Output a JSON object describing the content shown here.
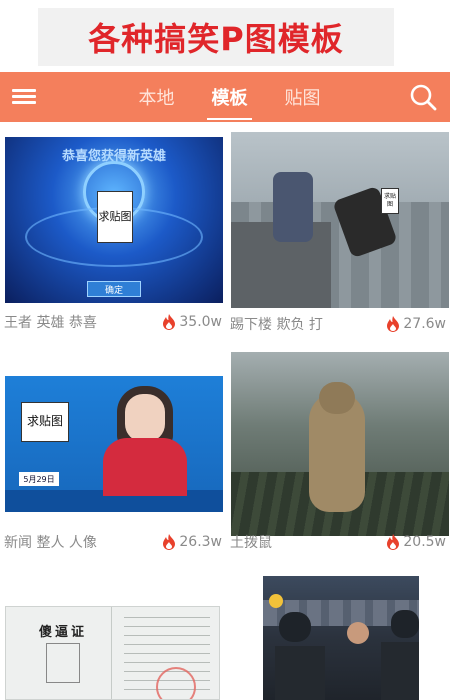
{
  "banner": {
    "title": "各种搞笑P图模板"
  },
  "header": {
    "tabs": [
      {
        "label": "本地",
        "active": false
      },
      {
        "label": "模板",
        "active": true
      },
      {
        "label": "贴图",
        "active": false
      }
    ],
    "accent": "#f47f5c"
  },
  "cards": [
    {
      "tags": "王者 英雄 恭喜",
      "heat": "35.0w",
      "caption_top": "恭喜您获得新英雄",
      "placeholder": "求贴图",
      "button": "确定"
    },
    {
      "tags": "踢下楼 欺负 打",
      "heat": "27.6w",
      "placeholder": "求贴图"
    },
    {
      "tags": "新闻 整人 人像",
      "heat": "26.3w",
      "placeholder": "求贴图",
      "date_badge": "5月29日"
    },
    {
      "tags": "土拨鼠",
      "heat": "20.5w"
    },
    {
      "doc_title": "傻逼证"
    },
    {}
  ],
  "colors": {
    "flame": "#e8412c",
    "tag_text": "#8a8a8a",
    "banner_text": "#e0262a"
  }
}
